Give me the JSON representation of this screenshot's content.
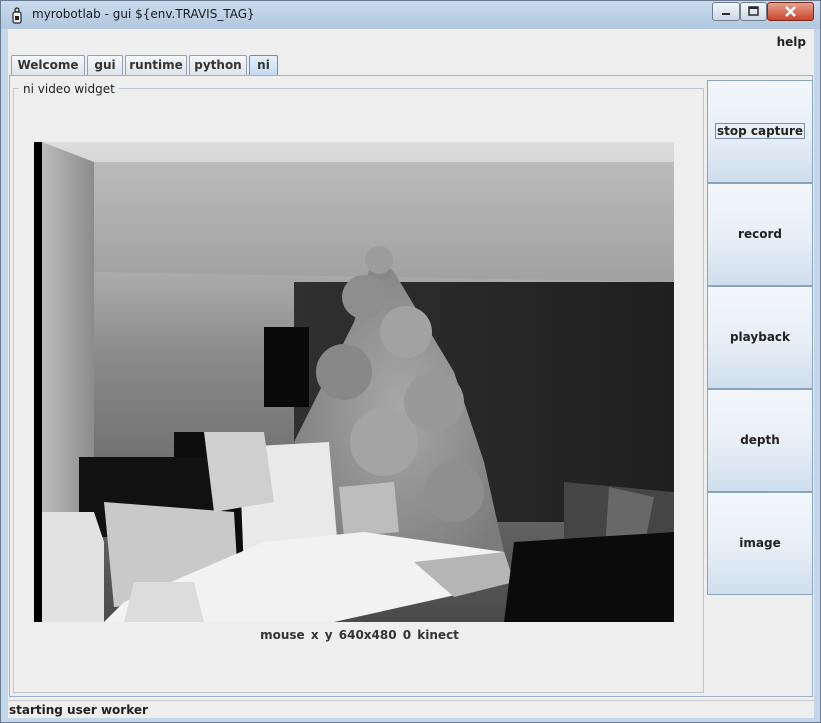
{
  "window": {
    "title": "myrobotlab - gui ${env.TRAVIS_TAG}",
    "controls": {
      "minimize_icon": "minimize-icon",
      "maximize_icon": "maximize-icon",
      "close_icon": "close-icon"
    }
  },
  "menubar": {
    "help": "help"
  },
  "tabs": [
    {
      "label": "Welcome",
      "active": false
    },
    {
      "label": "gui",
      "active": false
    },
    {
      "label": "runtime",
      "active": false
    },
    {
      "label": "python",
      "active": false
    },
    {
      "label": "ni",
      "active": true
    }
  ],
  "panel": {
    "group_title": "ni  video widget",
    "caption": "mouse x y  640x480  0  kinect"
  },
  "buttons": [
    {
      "label": "stop capture",
      "focused": true
    },
    {
      "label": "record",
      "focused": false
    },
    {
      "label": "playback",
      "focused": false
    },
    {
      "label": "depth",
      "focused": false
    },
    {
      "label": "image",
      "focused": false
    }
  ],
  "status": "starting user worker",
  "colors": {
    "titlebar": "#c3d7ea",
    "active_tab": "#c4daf0",
    "button": "#cfdeed"
  }
}
